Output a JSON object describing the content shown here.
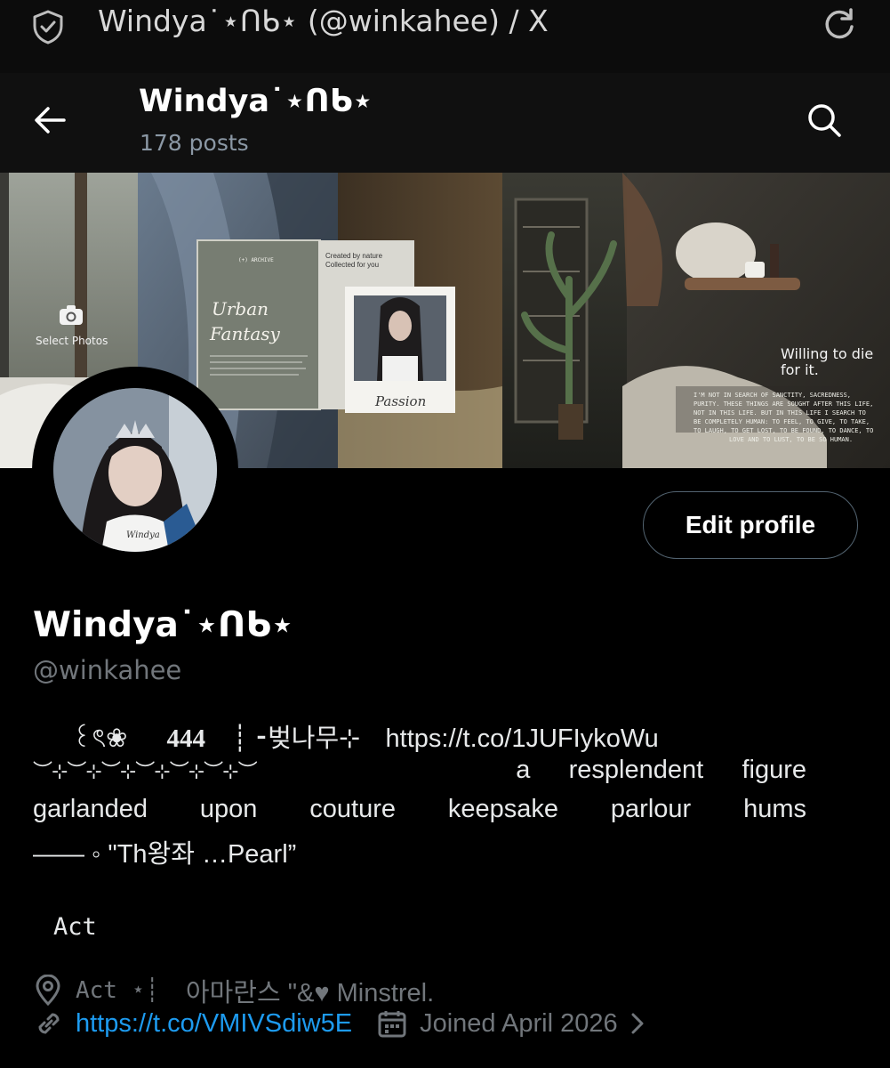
{
  "browser": {
    "tab_title": "Windya˙⋆ᑎᑲ⋆ (@winkahee) / X"
  },
  "header": {
    "name": "Windya˙⋆ᑎᑲ⋆",
    "posts": "178 posts"
  },
  "banner": {
    "select_photos_label": "Select Photos",
    "quote": "Willing to die for it."
  },
  "profile": {
    "edit_button_label": "Edit profile",
    "display_name": "Windya˙⋆ᑎᑲ⋆",
    "handle": "@winkahee",
    "bio": {
      "line1_a": "꒰ৎ❀",
      "line1_b": "444",
      "line1_c": "┊ ⁃벚나무⊹",
      "line1_link": "https://t.co/1JUFIykoWu",
      "line2_deco": "︶⊹︶⊹︶⊹︶⊹︶⊹︶⊹︶",
      "line2_words": [
        "a",
        "resplendent",
        "figure"
      ],
      "line3_words": [
        "garlanded",
        "upon",
        "couture",
        "keepsake",
        "parlour",
        "hums"
      ],
      "line4": "——  ◦ \"Th왕좌  …Pearl”"
    },
    "act_label": "Act",
    "location": {
      "act": "Act ⋆┊",
      "text": "아마란스  \"&♥  Minstrel."
    },
    "website": "https://t.co/VMIVSdiw5E",
    "joined": "Joined April 2026"
  },
  "colors": {
    "background": "#000000",
    "link": "#1d9bf0",
    "secondary_text": "#71767b",
    "button_border": "#536471"
  }
}
